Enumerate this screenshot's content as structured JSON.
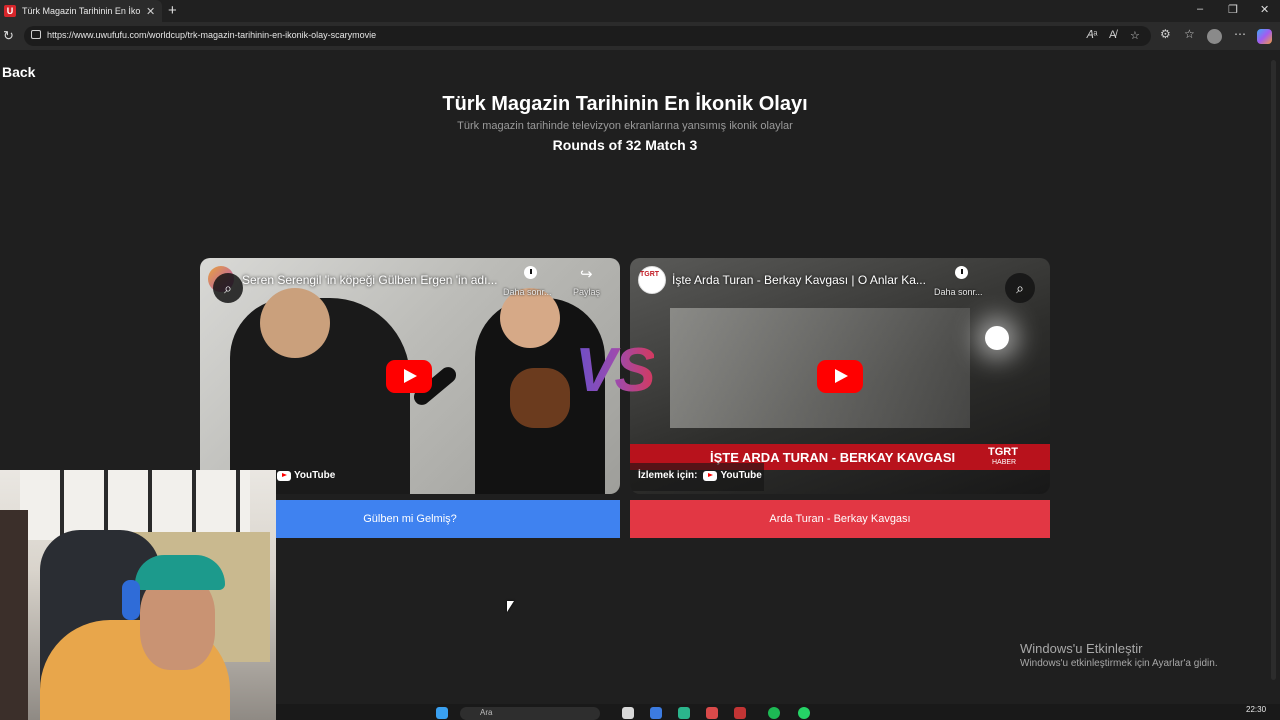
{
  "browser": {
    "tab_title": "Türk Magazin Tarihinin En İkonik Olayı",
    "tab_close": "✕",
    "new_tab": "+",
    "url": "https://www.uwufufu.com/worldcup/trk-magazin-tarihinin-en-ikonik-olay-scarymovie",
    "window_controls": [
      "–",
      "❐",
      "✕"
    ],
    "favicon_letter": "U",
    "icons": [
      "reload-icon",
      "lock-icon",
      "read-aloud-icon",
      "immersive-reader-icon",
      "favorite-star-icon",
      "extensions-icon",
      "collections-icon",
      "profile-icon",
      "menu-icon",
      "copilot-icon"
    ]
  },
  "page": {
    "back_label": "Back",
    "title": "Türk Magazin Tarihinin En İkonik Olayı",
    "subtitle": "Türk magazin tarihinde televizyon ekranlarına yansımış ikonik olaylar",
    "round_label": "Rounds of 32 Match 3",
    "vs_label": "VS"
  },
  "matchup": {
    "left": {
      "video_title": "Seren Serengil 'in köpeği Gülben Ergen 'in adı...",
      "later_label": "Daha sonr...",
      "share_label": "Paylaş",
      "youtube_label": "YouTube",
      "choice_label": "Gülben mi Gelmiş?",
      "color": "#3f82f0"
    },
    "right": {
      "video_title": "İşte Arda Turan - Berkay Kavgası | O Anlar Ka...",
      "later_label": "Daha sonr...",
      "channel_label": "TGRT HABER",
      "banner_text": "İŞTE ARDA TURAN - BERKAY KAVGASI",
      "banner_logo": "TGRT",
      "banner_logo_sub": "HABER",
      "watch_label": "İzlemek için:",
      "youtube_label": "YouTube",
      "choice_label": "Arda Turan - Berkay Kavgası",
      "color": "#e23744"
    }
  },
  "windows": {
    "activate_title": "Windows'u Etkinleştir",
    "activate_sub": "Windows'u etkinleştirmek için Ayarlar'a gidin.",
    "search_placeholder": "Ara",
    "clock": "22:30"
  }
}
